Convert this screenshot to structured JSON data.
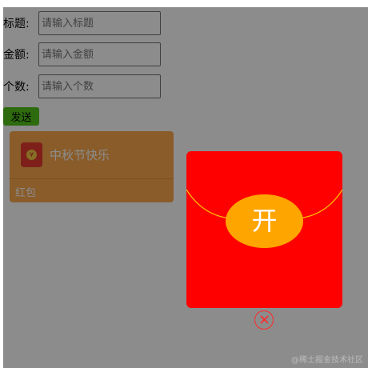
{
  "form": {
    "title_label": "标题:",
    "title_placeholder": "请输入标题",
    "amount_label": "金额:",
    "amount_placeholder": "请输入金额",
    "count_label": "个数:",
    "count_placeholder": "请输入个数",
    "send_label": "发送"
  },
  "card": {
    "title": "中秋节快乐",
    "type_label": "红包",
    "icon": "red-envelope-icon"
  },
  "envelope": {
    "open_label": "开",
    "close_icon": "close-circle-icon"
  },
  "watermark": "@稀土掘金技术社区",
  "colors": {
    "send_button": "#52c41a",
    "card": "#f9a84d",
    "envelope": "#ff0000",
    "open_button": "#ffa500",
    "close": "#ff2a2a"
  }
}
